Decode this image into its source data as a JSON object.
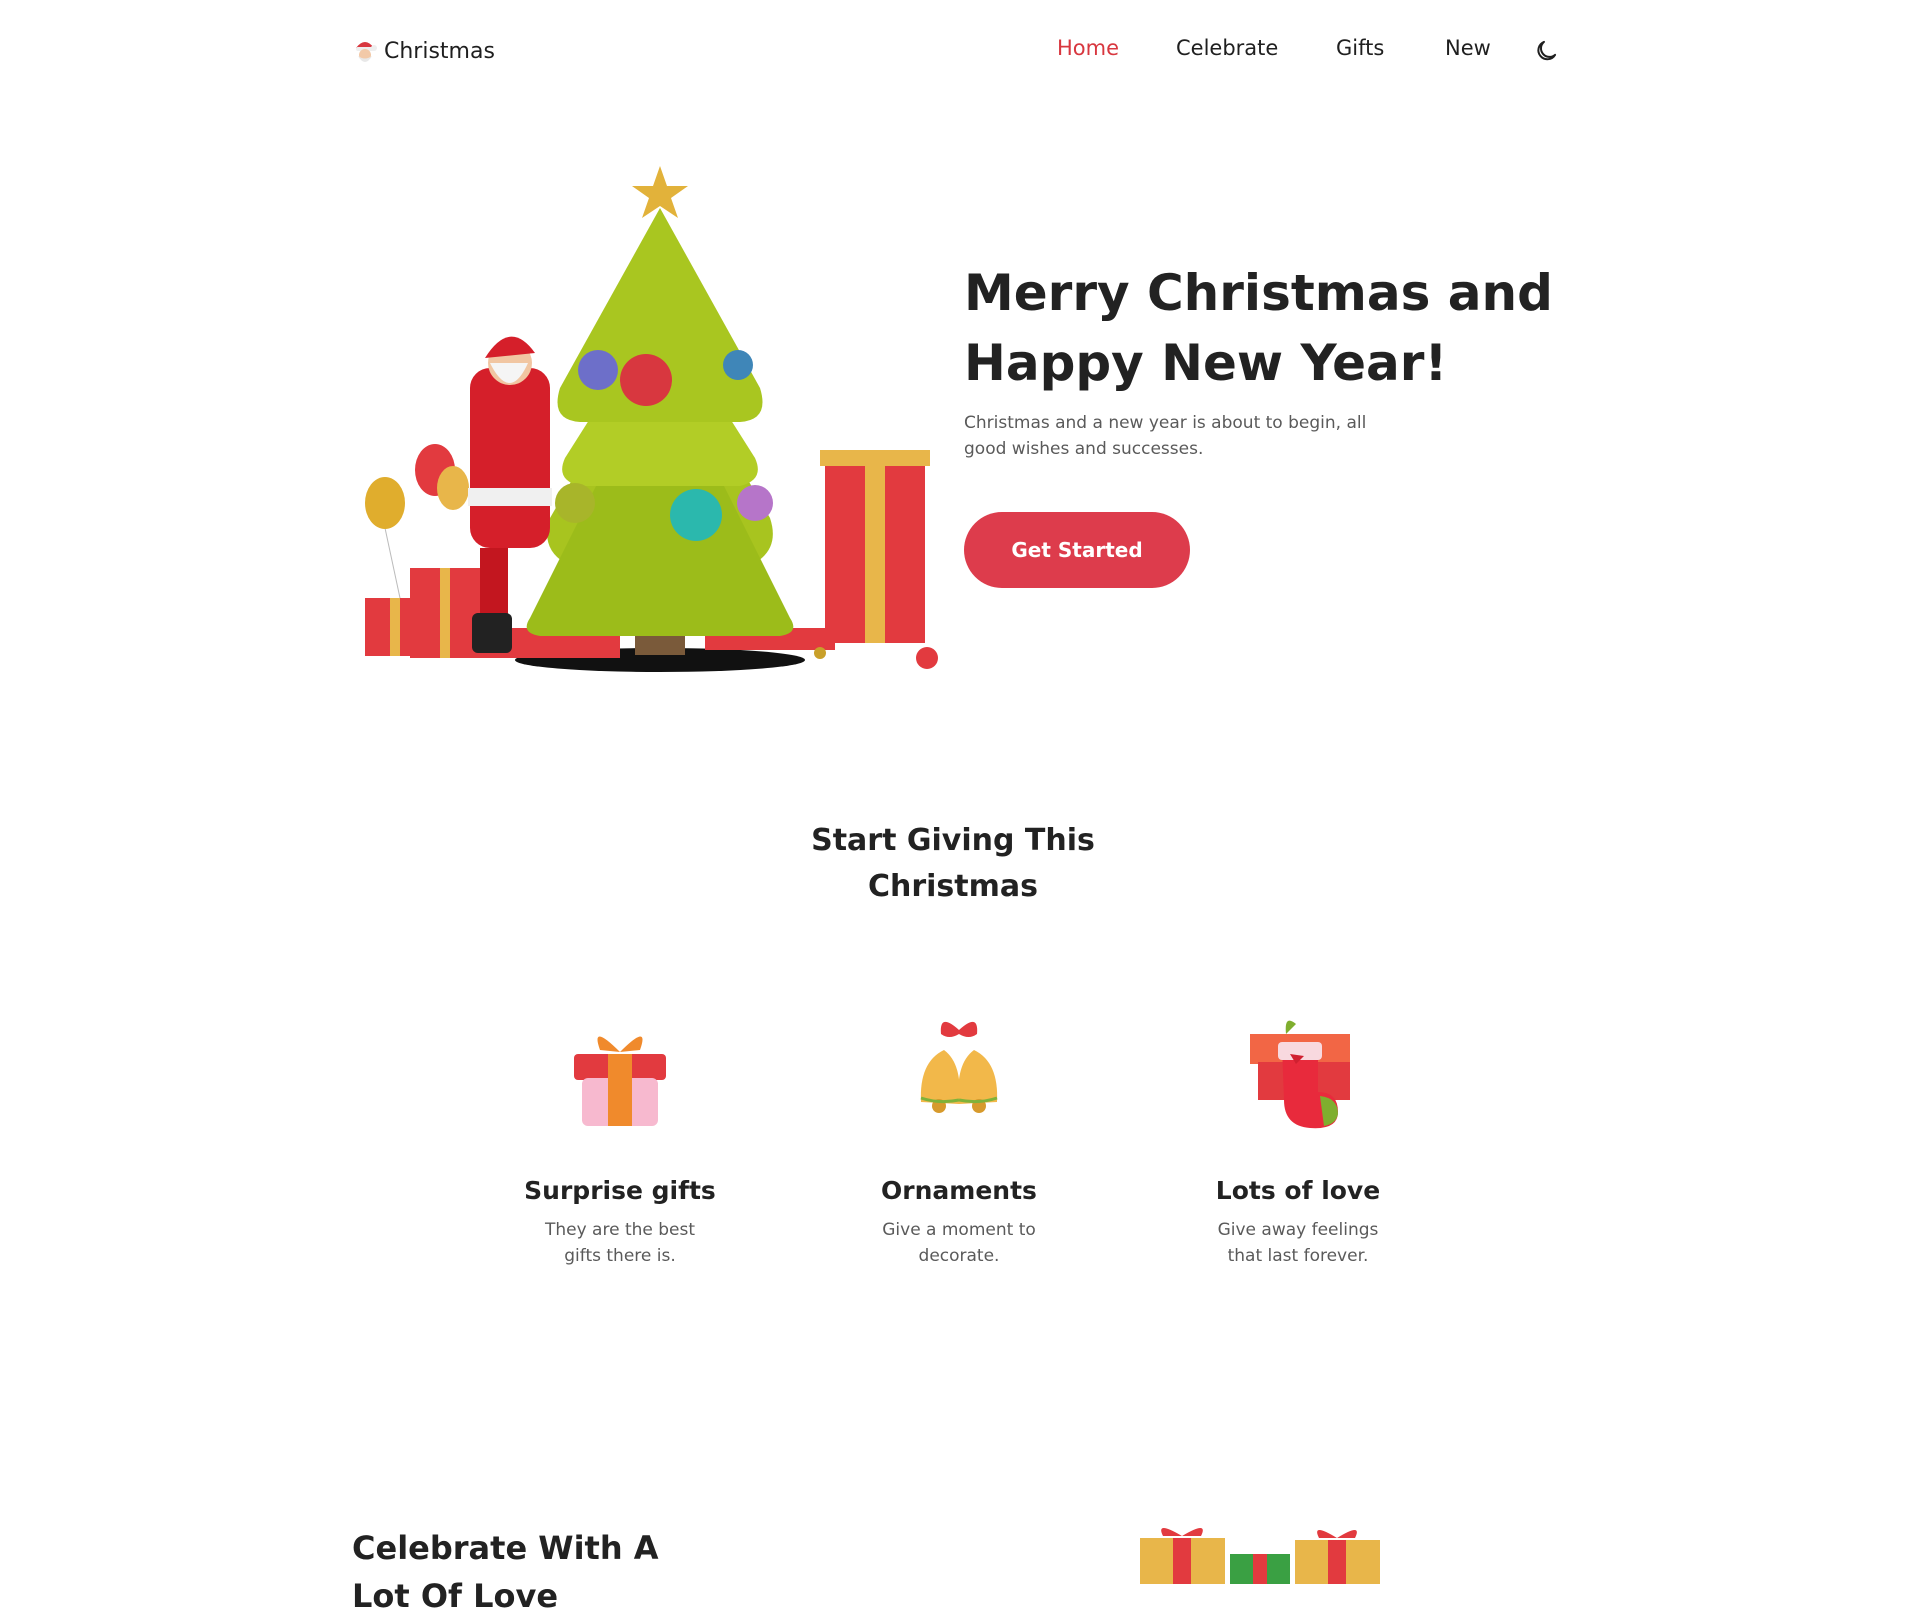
{
  "header": {
    "logo": {
      "text": "Christmas",
      "icon": "santa-icon"
    },
    "nav": [
      {
        "label": "Home",
        "active": true
      },
      {
        "label": "Celebrate",
        "active": false
      },
      {
        "label": "Gifts",
        "active": false
      },
      {
        "label": "New",
        "active": false
      }
    ],
    "theme_toggle_icon": "moon-icon"
  },
  "hero": {
    "title_line1": "Merry Christmas and",
    "title_line2": "Happy New Year!",
    "description": "Christmas and a new year is about to begin, all good wishes and successes.",
    "cta_label": "Get Started"
  },
  "giving": {
    "title_line1": "Start Giving This",
    "title_line2": "Christmas",
    "cards": [
      {
        "icon": "gift-box-icon",
        "title": "Surprise gifts",
        "text": "They are the best gifts there is."
      },
      {
        "icon": "bells-icon",
        "title": "Ornaments",
        "text": "Give a moment to decorate."
      },
      {
        "icon": "stocking-icon",
        "title": "Lots of love",
        "text": "Give away feelings that last forever."
      }
    ]
  },
  "celebrate": {
    "title_line1": "Celebrate With A",
    "title_line2": "Lot Of Love"
  },
  "colors": {
    "accent": "#dd3c4c",
    "nav_active": "#d8373f",
    "text": "#222222",
    "muted": "#5a5a5a",
    "tree_green": "#9cbc1a",
    "gift_red": "#e23a3f",
    "gift_gold": "#e8b64a"
  }
}
